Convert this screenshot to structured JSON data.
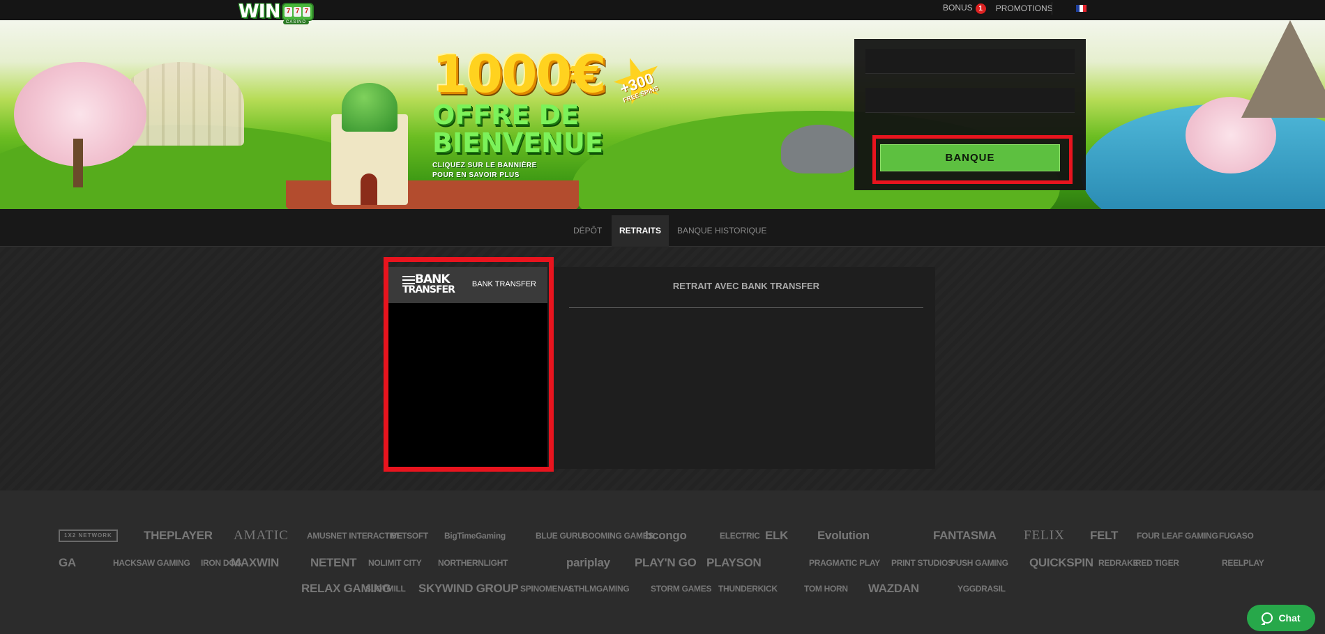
{
  "header": {
    "logo_text": "WIN",
    "logo_sub": "CASINO",
    "bonus_label": "BONUS",
    "bonus_count": "1",
    "promotions_label": "PROMOTIONS",
    "flag_colors": [
      "#1e3f9c",
      "#ffffff",
      "#e3232c"
    ]
  },
  "banner": {
    "amount": "1000€",
    "offer_line1": "OFFRE DE",
    "offer_line2": "BIENVENUE",
    "hint": "CLIQUEZ SUR LE BANNIÈRE POUR EN SAVOIR PLUS",
    "spins_count": "+300",
    "spins_label": "FREE SPINS",
    "slide_count": 5,
    "active_slide": 1
  },
  "account": {
    "bank_button_label": "BANQUE"
  },
  "tabs": [
    {
      "label": "DÉPÔT",
      "active": false
    },
    {
      "label": "RETRAITS",
      "active": true
    },
    {
      "label": "BANQUE HISTORIQUE",
      "active": false
    }
  ],
  "withdrawal": {
    "method_logo_line1": "BANK",
    "method_logo_line2": "TRANSFER",
    "method_label": "BANK TRANSFER",
    "panel_title": "RETRAIT AVEC BANK TRANSFER"
  },
  "providers": {
    "row1": [
      "1X2 NETWORK",
      "THEPLAYER",
      "AMATIC",
      "AMUSNET INTERACTIVE",
      "BETSOFT",
      "BigTimeGaming",
      "BLUE GURU",
      "BOOMING GAMES",
      "bcongo",
      "ELECTRIC",
      "ELK",
      "Evolution",
      "FANTASMA",
      "FELIX",
      "FELT",
      "FOUR LEAF GAMING",
      "FUGASO"
    ],
    "row2": [
      "GA",
      "HACKSAW GAMING",
      "IRON DOG",
      "MAXWIN",
      "NETENT",
      "NOLIMIT CITY",
      "NORTHERNLIGHT",
      "pariplay",
      "PLAY'N GO",
      "PLAYSON",
      "PRAGMATIC PLAY",
      "PRINT STUDIOS",
      "PUSH GAMING",
      "QUICKSPIN",
      "REDRAKE",
      "RED TIGER",
      "REELPLAY"
    ],
    "row3": [
      "RELAX GAMING",
      "SLOTMILL",
      "SKYWIND GROUP",
      "SPINOMENAL",
      "STHLMGAMING",
      "STORM GAMES",
      "THUNDERKICK",
      "TOM HORN",
      "WAZDAN",
      "YGGDRASIL"
    ]
  },
  "chat": {
    "label": "Chat"
  }
}
